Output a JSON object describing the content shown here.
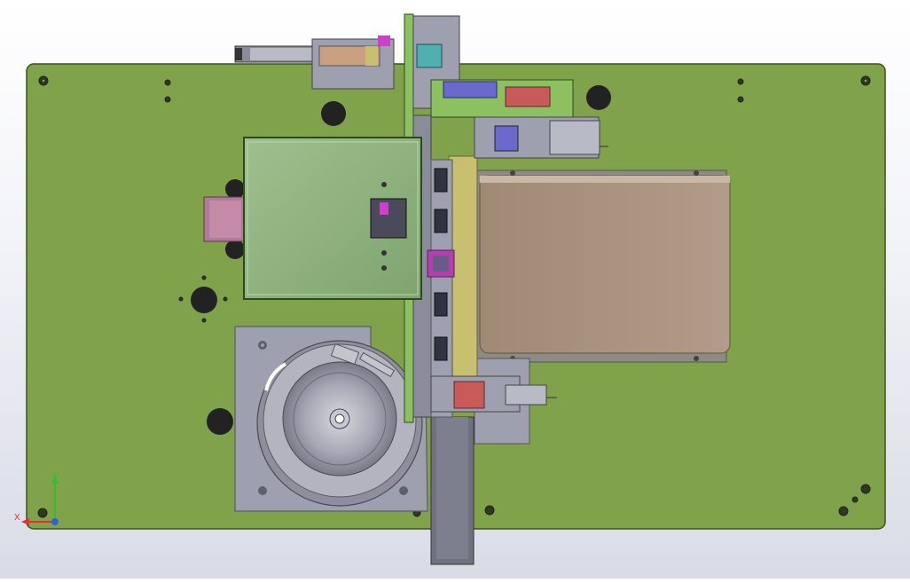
{
  "viewport": {
    "background_top": "#ffffff",
    "background_bottom": "#d9dbe6"
  },
  "colors": {
    "base_plate": "#7fa24a",
    "base_plate_edge": "#3d5220",
    "steel": "#9ea0b0",
    "steel_dark": "#6f7180",
    "cover_panel": "#8fb57e",
    "conveyor": "#a89480",
    "bracket_yellow": "#c8c070",
    "accent_blue": "#6a6acd",
    "accent_magenta": "#b040b0",
    "accent_red": "#c85a5a",
    "accent_cyan": "#50b0b0",
    "triad_x": "#e03030",
    "triad_y": "#30c030",
    "triad_z": "#3060e0"
  },
  "triad": {
    "x_label": "X",
    "y_label": "Y"
  },
  "components": {
    "base_plate": "base-plate",
    "vibratory_bowl": "vibratory-bowl-feeder",
    "conveyor": "belt-conveyor",
    "cover": "protective-cover",
    "top_cylinder": "pneumatic-cylinder"
  }
}
